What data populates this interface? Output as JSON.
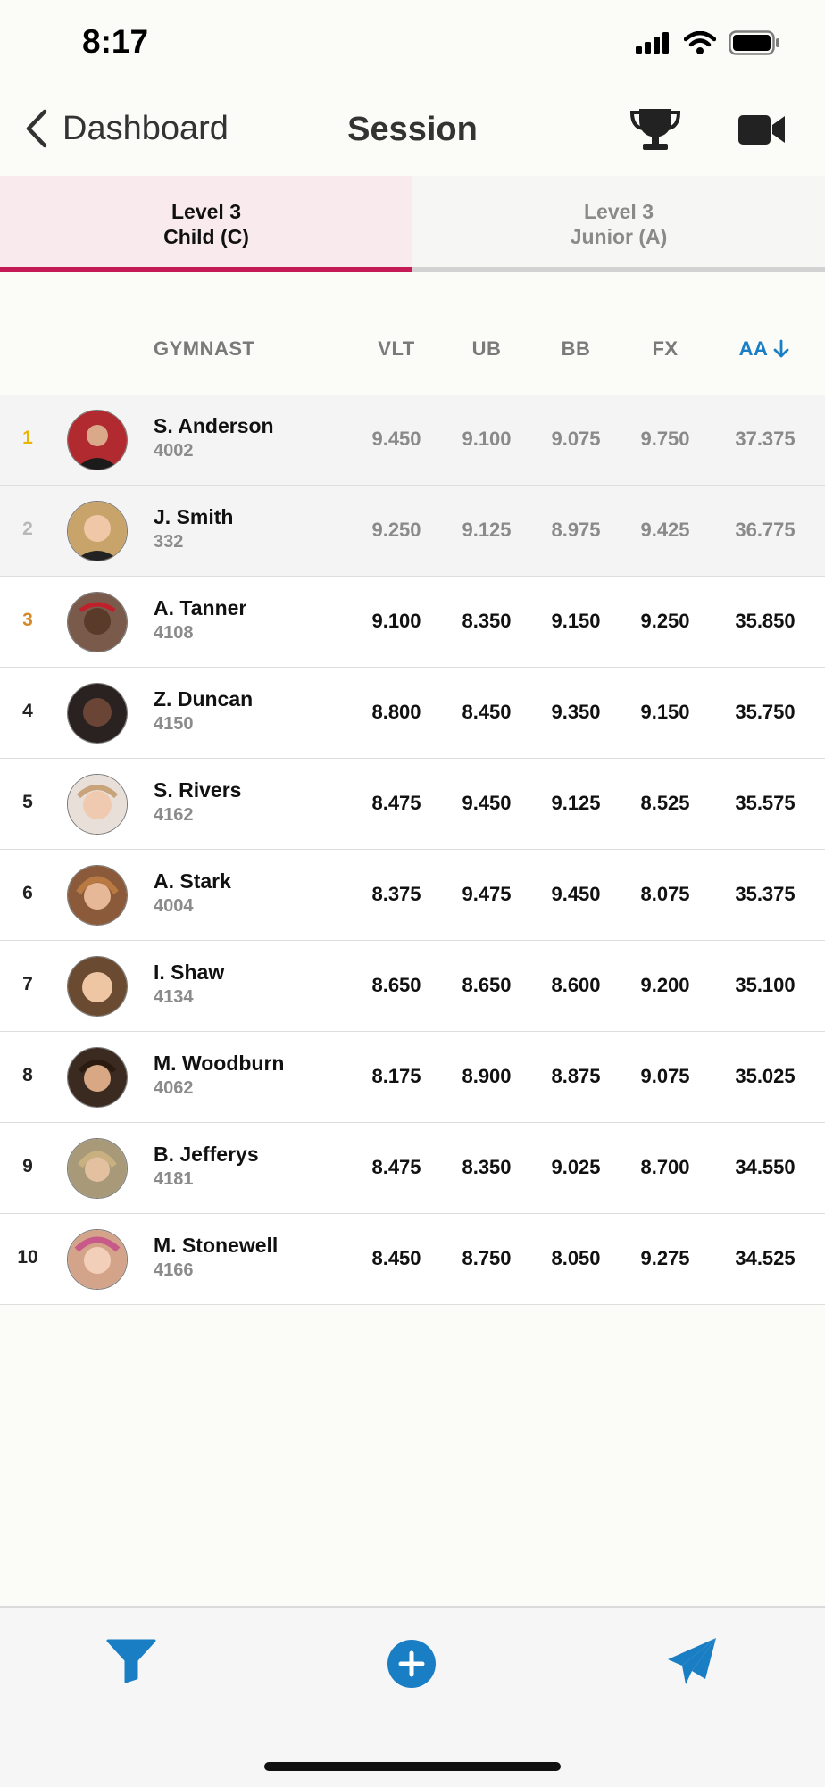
{
  "status_bar": {
    "time": "8:17"
  },
  "nav": {
    "back_label": "Dashboard",
    "title": "Session"
  },
  "tabs": [
    {
      "line1": "Level 3",
      "line2": "Child (C)",
      "active": true
    },
    {
      "line1": "Level 3",
      "line2": "Junior (A)",
      "active": false
    }
  ],
  "columns": {
    "gymnast": "GYMNAST",
    "vlt": "VLT",
    "ub": "UB",
    "bb": "BB",
    "fx": "FX",
    "aa": "AA"
  },
  "colors": {
    "accent": "#c41b57",
    "link": "#1a7ec5",
    "gold": "#e8b400",
    "silver": "#b8b8b8",
    "bronze": "#d58a27"
  },
  "gymnasts": [
    {
      "rank": "1",
      "name": "S. Anderson",
      "number": "4002",
      "vlt": "9.450",
      "ub": "9.100",
      "bb": "9.075",
      "fx": "9.750",
      "aa": "37.375"
    },
    {
      "rank": "2",
      "name": "J. Smith",
      "number": "332",
      "vlt": "9.250",
      "ub": "9.125",
      "bb": "8.975",
      "fx": "9.425",
      "aa": "36.775"
    },
    {
      "rank": "3",
      "name": "A. Tanner",
      "number": "4108",
      "vlt": "9.100",
      "ub": "8.350",
      "bb": "9.150",
      "fx": "9.250",
      "aa": "35.850"
    },
    {
      "rank": "4",
      "name": "Z. Duncan",
      "number": "4150",
      "vlt": "8.800",
      "ub": "8.450",
      "bb": "9.350",
      "fx": "9.150",
      "aa": "35.750"
    },
    {
      "rank": "5",
      "name": "S. Rivers",
      "number": "4162",
      "vlt": "8.475",
      "ub": "9.450",
      "bb": "9.125",
      "fx": "8.525",
      "aa": "35.575"
    },
    {
      "rank": "6",
      "name": "A. Stark",
      "number": "4004",
      "vlt": "8.375",
      "ub": "9.475",
      "bb": "9.450",
      "fx": "8.075",
      "aa": "35.375"
    },
    {
      "rank": "7",
      "name": "I. Shaw",
      "number": "4134",
      "vlt": "8.650",
      "ub": "8.650",
      "bb": "8.600",
      "fx": "9.200",
      "aa": "35.100"
    },
    {
      "rank": "8",
      "name": "M. Woodburn",
      "number": "4062",
      "vlt": "8.175",
      "ub": "8.900",
      "bb": "8.875",
      "fx": "9.075",
      "aa": "35.025"
    },
    {
      "rank": "9",
      "name": "B. Jefferys",
      "number": "4181",
      "vlt": "8.475",
      "ub": "8.350",
      "bb": "9.025",
      "fx": "8.700",
      "aa": "34.550"
    },
    {
      "rank": "10",
      "name": "M. Stonewell",
      "number": "4166",
      "vlt": "8.450",
      "ub": "8.750",
      "bb": "8.050",
      "fx": "9.275",
      "aa": "34.525"
    }
  ],
  "icons": {
    "back": "chevron-left-icon",
    "trophy": "trophy-icon",
    "video": "video-camera-icon",
    "sort": "arrow-down-icon",
    "filter": "filter-icon",
    "add": "plus-circle-icon",
    "send": "paper-plane-icon"
  }
}
